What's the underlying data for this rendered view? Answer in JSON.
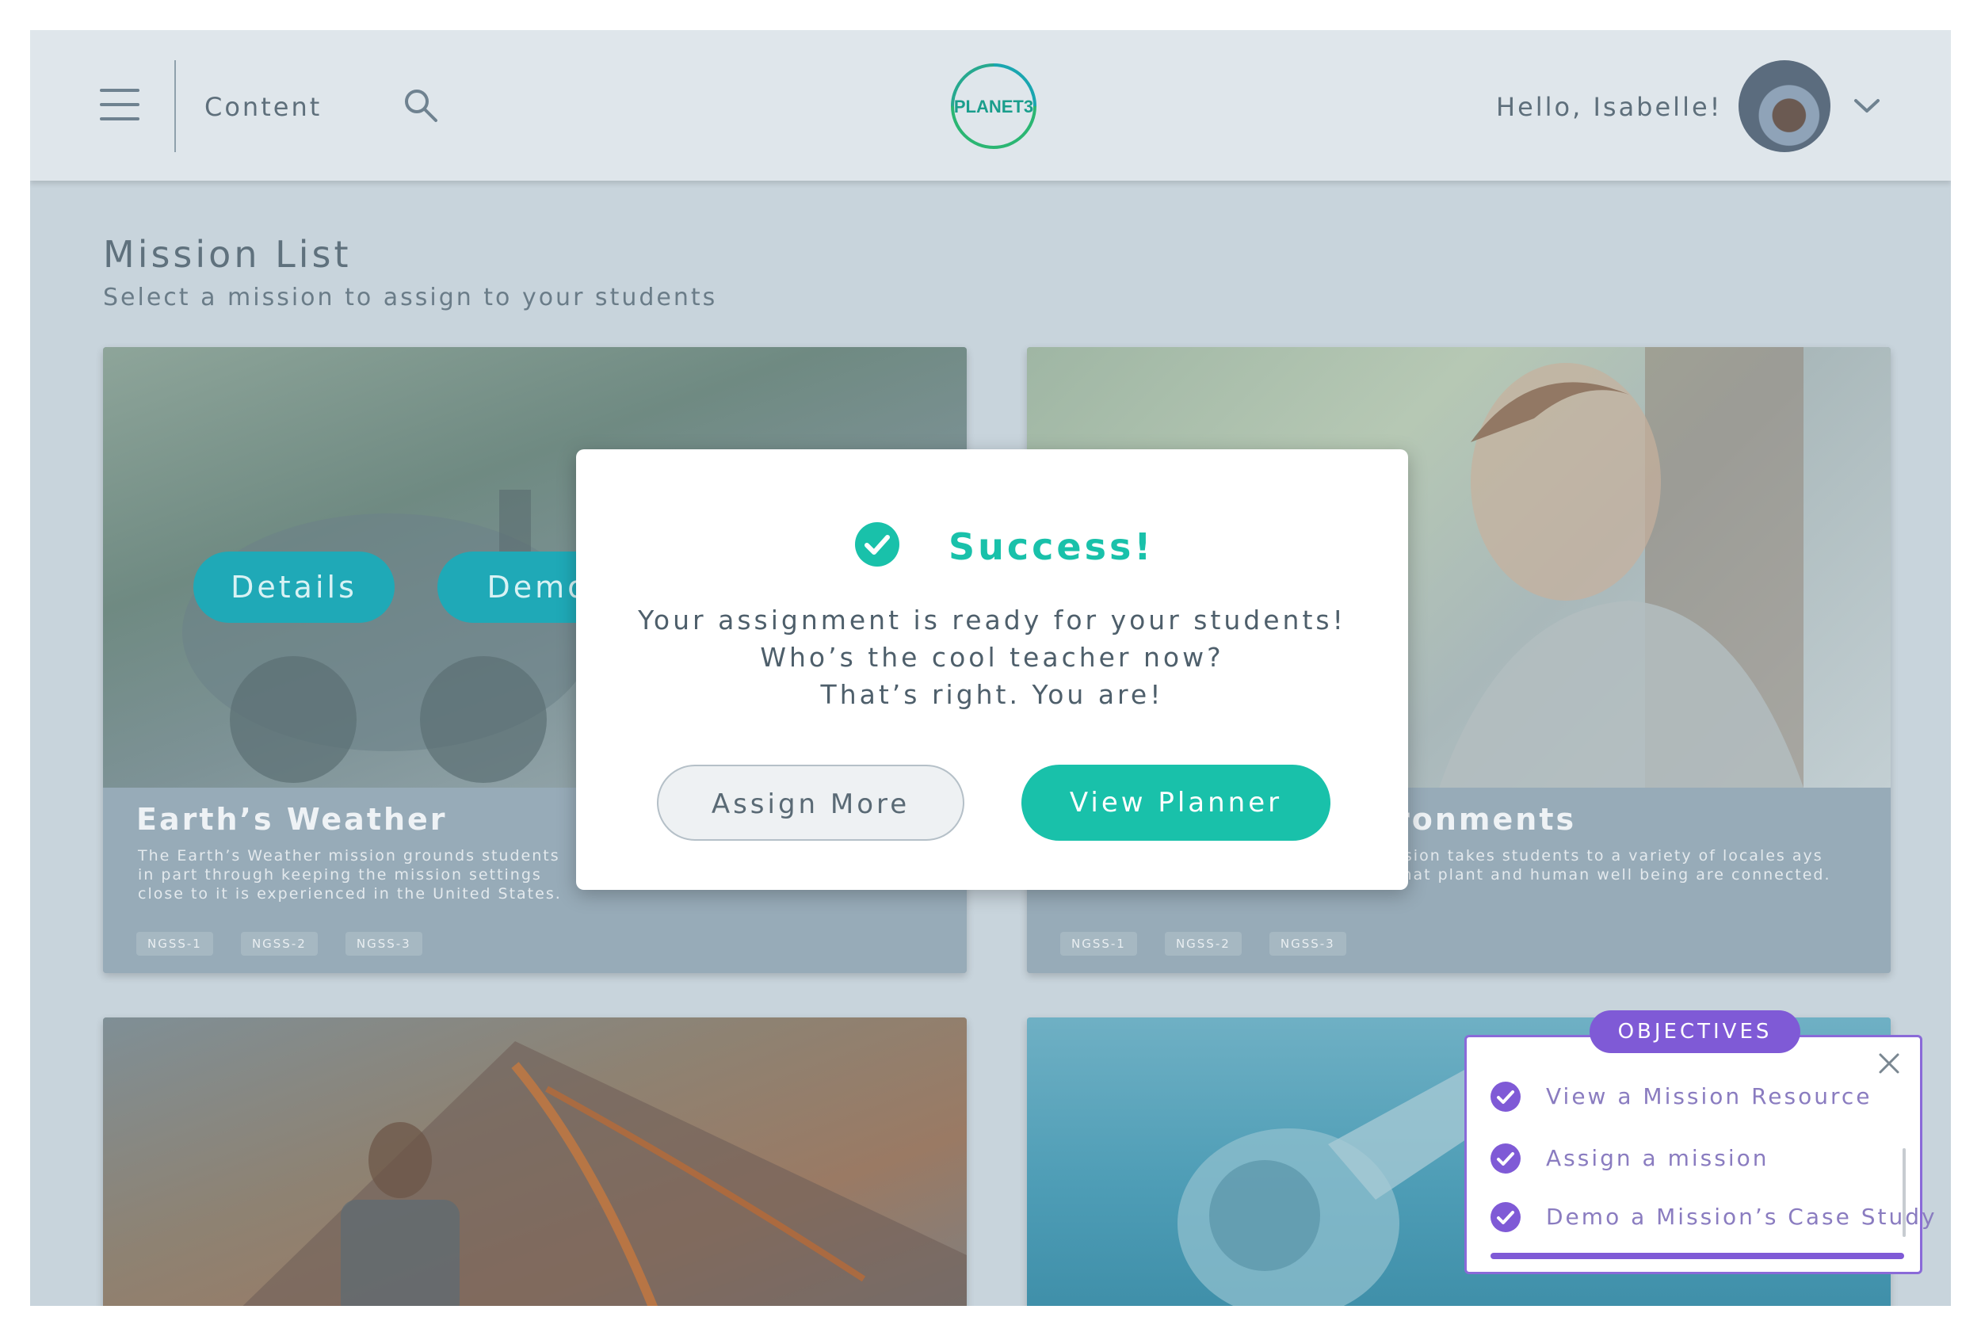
{
  "header": {
    "nav_label": "Content",
    "logo_text": "PLANET3",
    "greeting": "Hello, Isabelle!"
  },
  "page": {
    "title": "Mission List",
    "subtitle": "Select a mission to assign to your students"
  },
  "cards": [
    {
      "title": "Earth’s Weather",
      "description": "The Earth’s Weather mission grounds students in part through keeping the mission settings close to it is experienced in the United States.",
      "tags": [
        "NGSS-1",
        "NGSS-2",
        "NGSS-3"
      ],
      "details_label": "Details",
      "demo_label": "Demo"
    },
    {
      "title": "ronments",
      "description": "ssion takes students to a variety of locales ays that plant and human well being are connected.",
      "tags": [
        "NGSS-1",
        "NGSS-2",
        "NGSS-3"
      ]
    }
  ],
  "modal": {
    "heading": "Success!",
    "line1": "Your assignment is ready for your students!",
    "line2": "Who’s the cool teacher now?",
    "line3": "That’s right.  You are!",
    "assign_more": "Assign More",
    "view_planner": "View Planner"
  },
  "objectives": {
    "badge": "OBJECTIVES",
    "items": [
      {
        "label": "View a Mission Resource",
        "done": true
      },
      {
        "label": "Assign a mission",
        "done": true
      },
      {
        "label": "Demo a Mission’s Case Study",
        "done": true
      }
    ],
    "progress": 1.0
  },
  "colors": {
    "accent": "#19c1aa",
    "objectives": "#7f5ad6",
    "pill": "#1fa9b7"
  }
}
